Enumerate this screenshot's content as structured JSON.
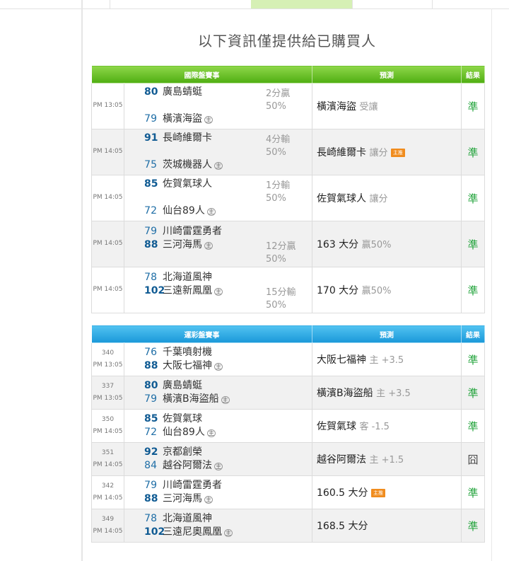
{
  "title": "以下資訊僅提供給已購買人",
  "intl": {
    "header": {
      "event": "國際盤賽事",
      "pred": "預測",
      "result": "結果"
    },
    "rows": [
      {
        "time": "PM 13:05",
        "s1": "80",
        "t1": "廣島蜻蜓",
        "s2": "79",
        "t2": "橫濱海盜",
        "home": "主",
        "h1": "2分贏",
        "h2": "50%",
        "pred": "橫濱海盜",
        "pred_sub": "受讓",
        "badge": "",
        "result": "準"
      },
      {
        "time": "PM 14:05",
        "s1": "91",
        "t1": "長崎維爾卡",
        "s2": "75",
        "t2": "茨城機器人",
        "home": "主",
        "h1": "4分輸",
        "h2": "50%",
        "pred": "長崎維爾卡",
        "pred_sub": "讓分",
        "badge": "主推",
        "result": "準"
      },
      {
        "time": "PM 14:05",
        "s1": "85",
        "t1": "佐賀氣球人",
        "s2": "72",
        "t2": "仙台89人",
        "home": "主",
        "h1": "1分輸",
        "h2": "50%",
        "pred": "佐賀氣球人",
        "pred_sub": "讓分",
        "badge": "",
        "result": "準"
      },
      {
        "time": "PM 14:05",
        "s1": "79",
        "t1": "川崎雷霆勇者",
        "s2": "88",
        "t2": "三河海馬",
        "home": "主",
        "h1": "12分贏",
        "h2": "50%",
        "pred": "163 大分",
        "pred_sub": "贏50%",
        "badge": "",
        "result": "準"
      },
      {
        "time": "PM 14:05",
        "s1": "78",
        "t1": "北海道風神",
        "s2": "102",
        "t2": "三遠新鳳凰",
        "home": "主",
        "h1": "15分輸",
        "h2": "50%",
        "pred": "170 大分",
        "pred_sub": "贏50%",
        "badge": "",
        "result": "準"
      }
    ]
  },
  "lottery": {
    "header": {
      "event": "運彩盤賽事",
      "pred": "預測",
      "result": "結果"
    },
    "rows": [
      {
        "num": "340",
        "time": "PM 13:05",
        "s1": "76",
        "t1": "千葉噴射機",
        "s2": "88",
        "t2": "大阪七福神",
        "home": "主",
        "pred": "大阪七福神",
        "pred_sub": "主 +3.5",
        "badge": "",
        "result": "準"
      },
      {
        "num": "337",
        "time": "PM 13:05",
        "s1": "80",
        "t1": "廣島蜻蜓",
        "s2": "79",
        "t2": "橫濱B海盜船",
        "home": "主",
        "pred": "橫濱B海盜船",
        "pred_sub": "主 +3.5",
        "badge": "",
        "result": "準"
      },
      {
        "num": "350",
        "time": "PM 14:05",
        "s1": "85",
        "t1": "佐賀氣球",
        "s2": "72",
        "t2": "仙台89人",
        "home": "主",
        "pred": "佐賀氣球",
        "pred_sub": "客 -1.5",
        "badge": "",
        "result": "準"
      },
      {
        "num": "351",
        "time": "PM 14:05",
        "s1": "92",
        "t1": "京都創榮",
        "s2": "84",
        "t2": "越谷阿爾法",
        "home": "主",
        "pred": "越谷阿爾法",
        "pred_sub": "主 +1.5",
        "badge": "",
        "result": "囧"
      },
      {
        "num": "342",
        "time": "PM 14:05",
        "s1": "79",
        "t1": "川崎雷霆勇者",
        "s2": "88",
        "t2": "三河海馬",
        "home": "主",
        "pred": "160.5 大分",
        "pred_sub": "",
        "badge": "主推",
        "result": "準"
      },
      {
        "num": "349",
        "time": "PM 14:05",
        "s1": "78",
        "t1": "北海道風神",
        "s2": "102",
        "t2": "三遠尼奧鳳凰",
        "home": "主",
        "pred": "168.5 大分",
        "pred_sub": "",
        "badge": "",
        "result": "準"
      }
    ]
  }
}
